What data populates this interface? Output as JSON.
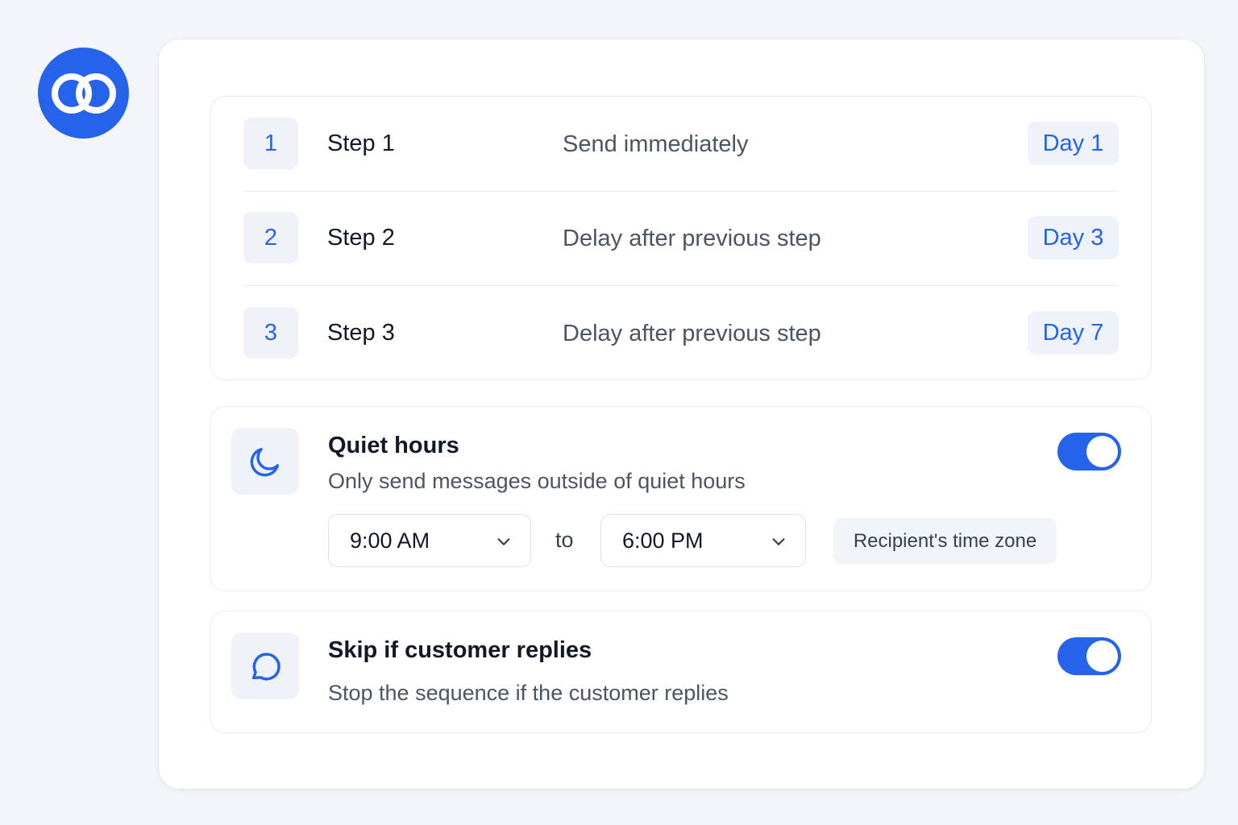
{
  "brand": {
    "accent": "#2563eb",
    "logo_icon": "linked-rings-icon"
  },
  "steps": [
    {
      "number": "1",
      "name": "Step 1",
      "description": "Send immediately",
      "day": "Day 1"
    },
    {
      "number": "2",
      "name": "Step 2",
      "description": "Delay after previous step",
      "day": "Day 3"
    },
    {
      "number": "3",
      "name": "Step 3",
      "description": "Delay after previous step",
      "day": "Day 7"
    }
  ],
  "quiet_hours": {
    "icon": "moon-icon",
    "title": "Quiet hours",
    "description": "Only send messages outside of quiet hours",
    "enabled": true,
    "start_time": "9:00 AM",
    "separator": "to",
    "end_time": "6:00 PM",
    "timezone": "Recipient's time zone"
  },
  "skip_on_reply": {
    "icon": "chat-bubble-icon",
    "title": "Skip if customer replies",
    "description": "Stop the sequence if the customer replies",
    "enabled": true
  }
}
